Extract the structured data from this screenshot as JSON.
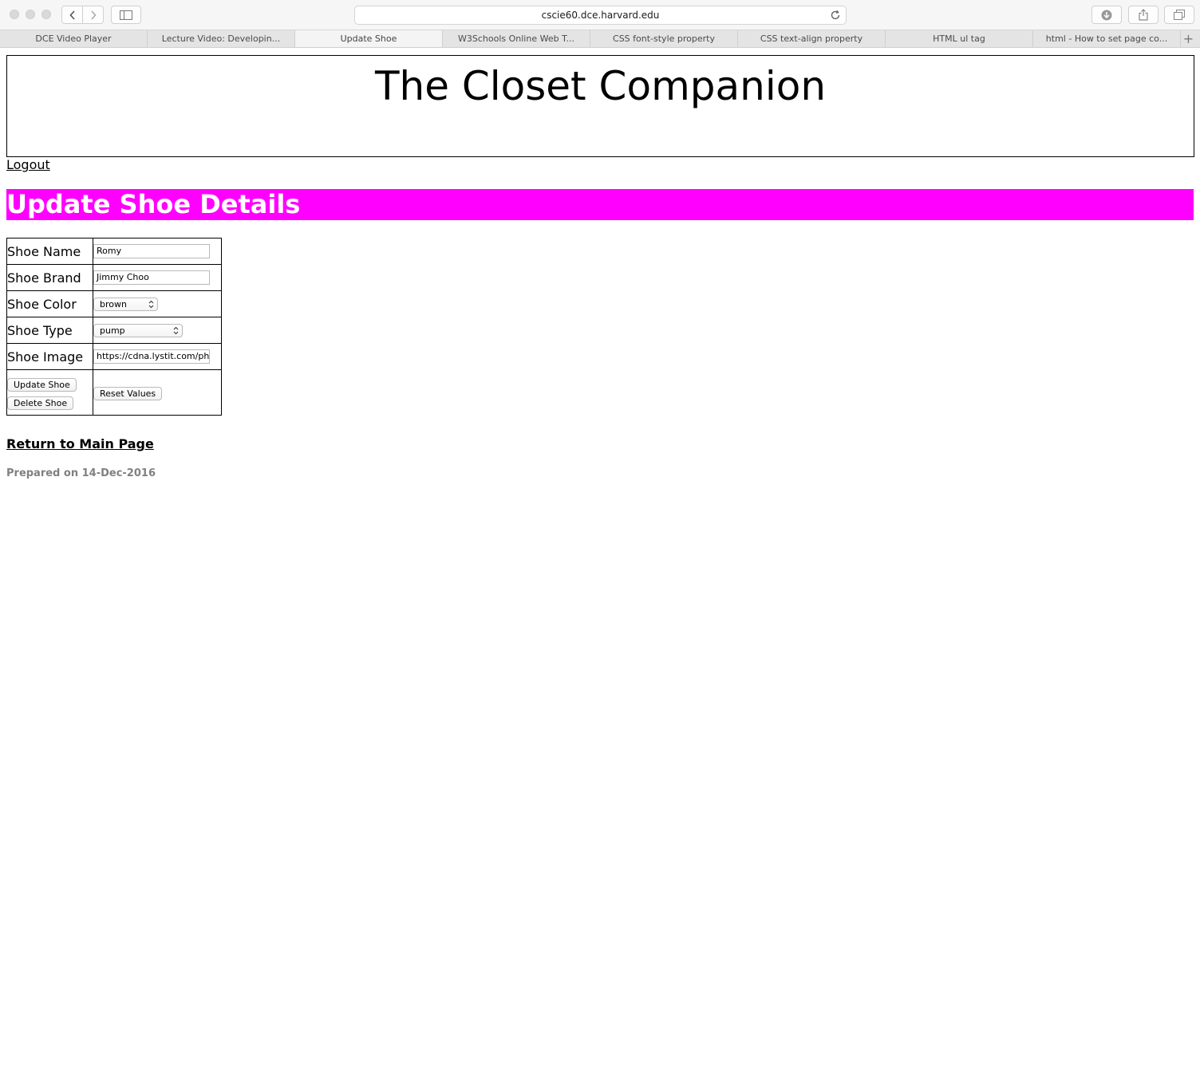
{
  "browser": {
    "url": "cscie60.dce.harvard.edu",
    "tabs": [
      {
        "label": "DCE Video Player"
      },
      {
        "label": "Lecture Video: Developin..."
      },
      {
        "label": "Update Shoe"
      },
      {
        "label": "W3Schools Online Web T..."
      },
      {
        "label": "CSS font-style property"
      },
      {
        "label": "CSS text-align property"
      },
      {
        "label": "HTML ul tag"
      },
      {
        "label": "html - How to set page co..."
      }
    ],
    "new_tab_label": "+"
  },
  "page": {
    "site_title": "The Closet Companion",
    "logout_label": "Logout",
    "heading": "Update Shoe Details",
    "heading_bg": "#ff00ff",
    "form": {
      "name_label": "Shoe Name",
      "name_value": "Romy",
      "brand_label": "Shoe Brand",
      "brand_value": "Jimmy Choo",
      "color_label": "Shoe Color",
      "color_value": "brown",
      "type_label": "Shoe Type",
      "type_value": "pump",
      "image_label": "Shoe Image",
      "image_value": "https://cdna.lystit.com/phc",
      "update_button": "Update Shoe",
      "delete_button": "Delete Shoe",
      "reset_button": "Reset Values"
    },
    "return_link": "Return to Main Page",
    "prepared": "Prepared on 14-Dec-2016"
  }
}
